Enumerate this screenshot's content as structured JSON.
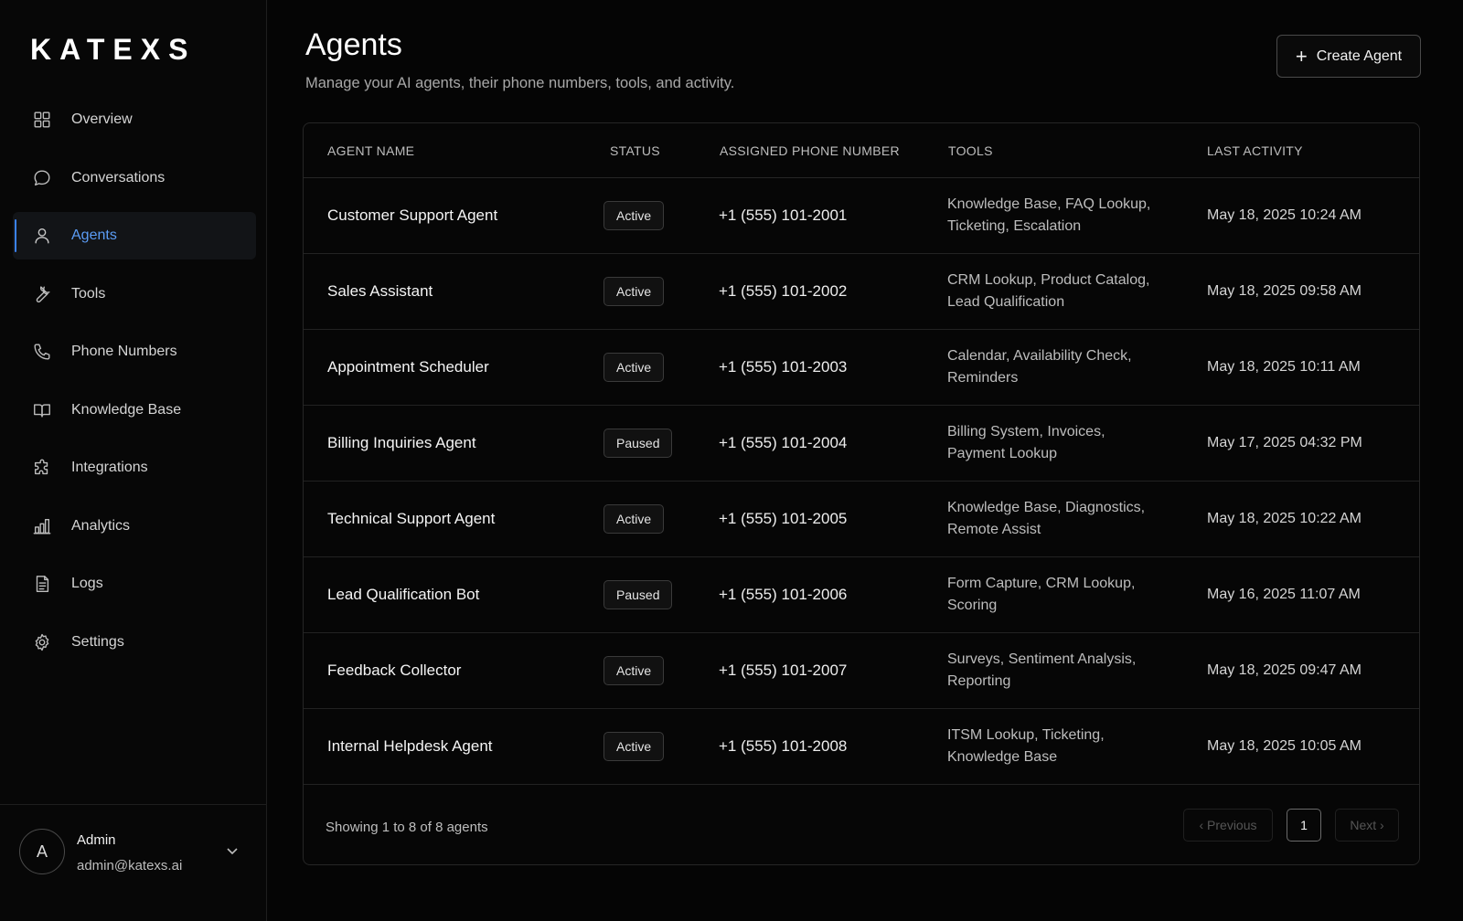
{
  "brand": {
    "logo": "KATEXS"
  },
  "sidebar": {
    "items": [
      {
        "label": "Overview",
        "icon": "grid-icon",
        "active": false
      },
      {
        "label": "Conversations",
        "icon": "chat-bubble-icon",
        "active": false
      },
      {
        "label": "Agents",
        "icon": "user-icon",
        "active": true
      },
      {
        "label": "Tools",
        "icon": "wrench-icon",
        "active": false
      },
      {
        "label": "Phone Numbers",
        "icon": "phone-icon",
        "active": false
      },
      {
        "label": "Knowledge Base",
        "icon": "book-icon",
        "active": false
      },
      {
        "label": "Integrations",
        "icon": "puzzle-icon",
        "active": false
      },
      {
        "label": "Analytics",
        "icon": "bar-chart-icon",
        "active": false
      },
      {
        "label": "Logs",
        "icon": "document-icon",
        "active": false
      },
      {
        "label": "Settings",
        "icon": "gear-icon",
        "active": false
      }
    ]
  },
  "user": {
    "initial": "A",
    "name": "Admin",
    "email": "admin@katexs.ai"
  },
  "header": {
    "title": "Agents",
    "subtitle": "Manage your AI agents, their phone numbers, tools, and activity.",
    "create_label": "Create Agent"
  },
  "table": {
    "columns": [
      "AGENT NAME",
      "STATUS",
      "ASSIGNED PHONE NUMBER",
      "TOOLS",
      "LAST ACTIVITY"
    ],
    "rows": [
      {
        "name": "Customer Support Agent",
        "status": "Active",
        "phone": "+1 (555) 101-2001",
        "tools_line1": "Knowledge Base, FAQ Lookup,",
        "tools_line2": "Ticketing, Escalation",
        "last": "May 18, 2025 10:24 AM"
      },
      {
        "name": "Sales Assistant",
        "status": "Active",
        "phone": "+1 (555) 101-2002",
        "tools_line1": "CRM Lookup, Product Catalog,",
        "tools_line2": "Lead Qualification",
        "last": "May 18, 2025 09:58 AM"
      },
      {
        "name": "Appointment Scheduler",
        "status": "Active",
        "phone": "+1 (555) 101-2003",
        "tools_line1": "Calendar, Availability Check,",
        "tools_line2": "Reminders",
        "last": "May 18, 2025 10:11 AM"
      },
      {
        "name": "Billing Inquiries Agent",
        "status": "Paused",
        "phone": "+1 (555) 101-2004",
        "tools_line1": "Billing System, Invoices,",
        "tools_line2": "Payment Lookup",
        "last": "May 17, 2025 04:32 PM"
      },
      {
        "name": "Technical Support Agent",
        "status": "Active",
        "phone": "+1 (555) 101-2005",
        "tools_line1": "Knowledge Base, Diagnostics,",
        "tools_line2": "Remote Assist",
        "last": "May 18, 2025 10:22 AM"
      },
      {
        "name": "Lead Qualification Bot",
        "status": "Paused",
        "phone": "+1 (555) 101-2006",
        "tools_line1": "Form Capture, CRM Lookup,",
        "tools_line2": "Scoring",
        "last": "May 16, 2025 11:07 AM"
      },
      {
        "name": "Feedback Collector",
        "status": "Active",
        "phone": "+1 (555) 101-2007",
        "tools_line1": "Surveys, Sentiment Analysis,",
        "tools_line2": "Reporting",
        "last": "May 18, 2025 09:47 AM"
      },
      {
        "name": "Internal Helpdesk Agent",
        "status": "Active",
        "phone": "+1 (555) 101-2008",
        "tools_line1": "ITSM Lookup, Ticketing,",
        "tools_line2": "Knowledge Base",
        "last": "May 18, 2025 10:05 AM"
      }
    ]
  },
  "footer": {
    "showing": "Showing 1 to 8 of 8 agents",
    "previous": "‹  Previous",
    "page": "1",
    "next": "Next  ›"
  }
}
